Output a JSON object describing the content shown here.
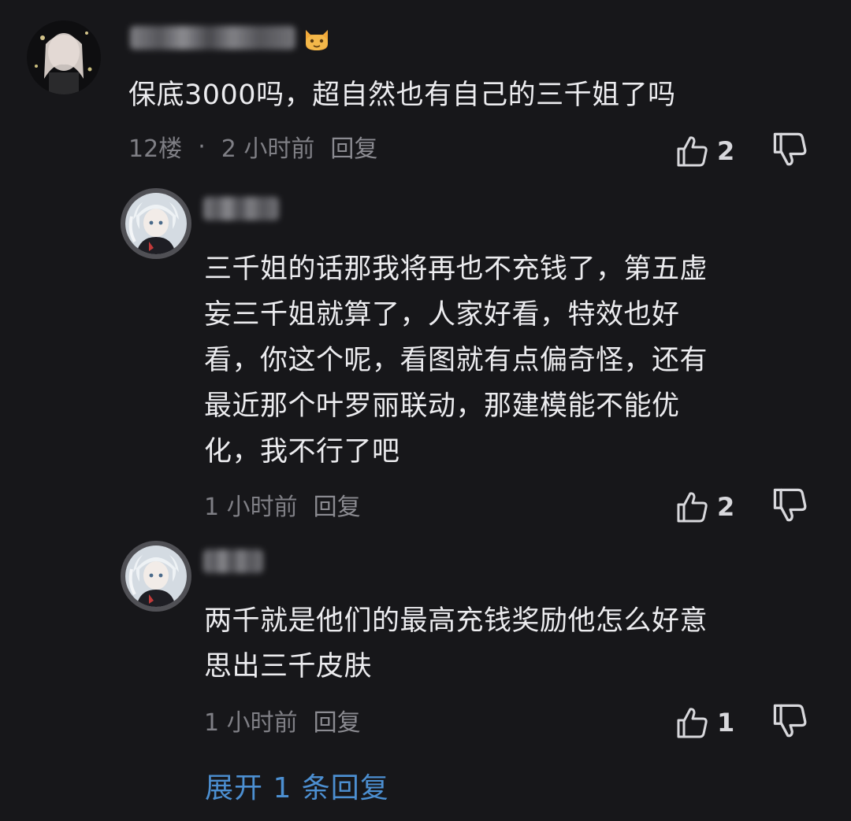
{
  "comments": [
    {
      "badge_icon": "orange-cat-face-icon",
      "content": "保底3000吗，超自然也有自己的三千姐了吗",
      "floor": "12楼",
      "separator": "·",
      "time": "2 小时前",
      "reply_label": "回复",
      "likes": "2"
    },
    {
      "content": "三千姐的话那我将再也不充钱了，第五虚\n妄三千姐就算了，人家好看，特效也好\n看，你这个呢，看图就有点偏奇怪，还有\n最近那个叶罗丽联动，那建模能不能优\n化，我不行了吧",
      "time": "1 小时前",
      "reply_label": "回复",
      "likes": "2"
    },
    {
      "content": "两千就是他们的最高充钱奖励他怎么好意\n思出三千皮肤",
      "time": "1 小时前",
      "reply_label": "回复",
      "likes": "1"
    }
  ],
  "expand_replies": "展开 1 条回复",
  "colors": {
    "background": "#17171a",
    "text": "#ececef",
    "meta": "#7f7f85",
    "link": "#4c8fd1"
  }
}
